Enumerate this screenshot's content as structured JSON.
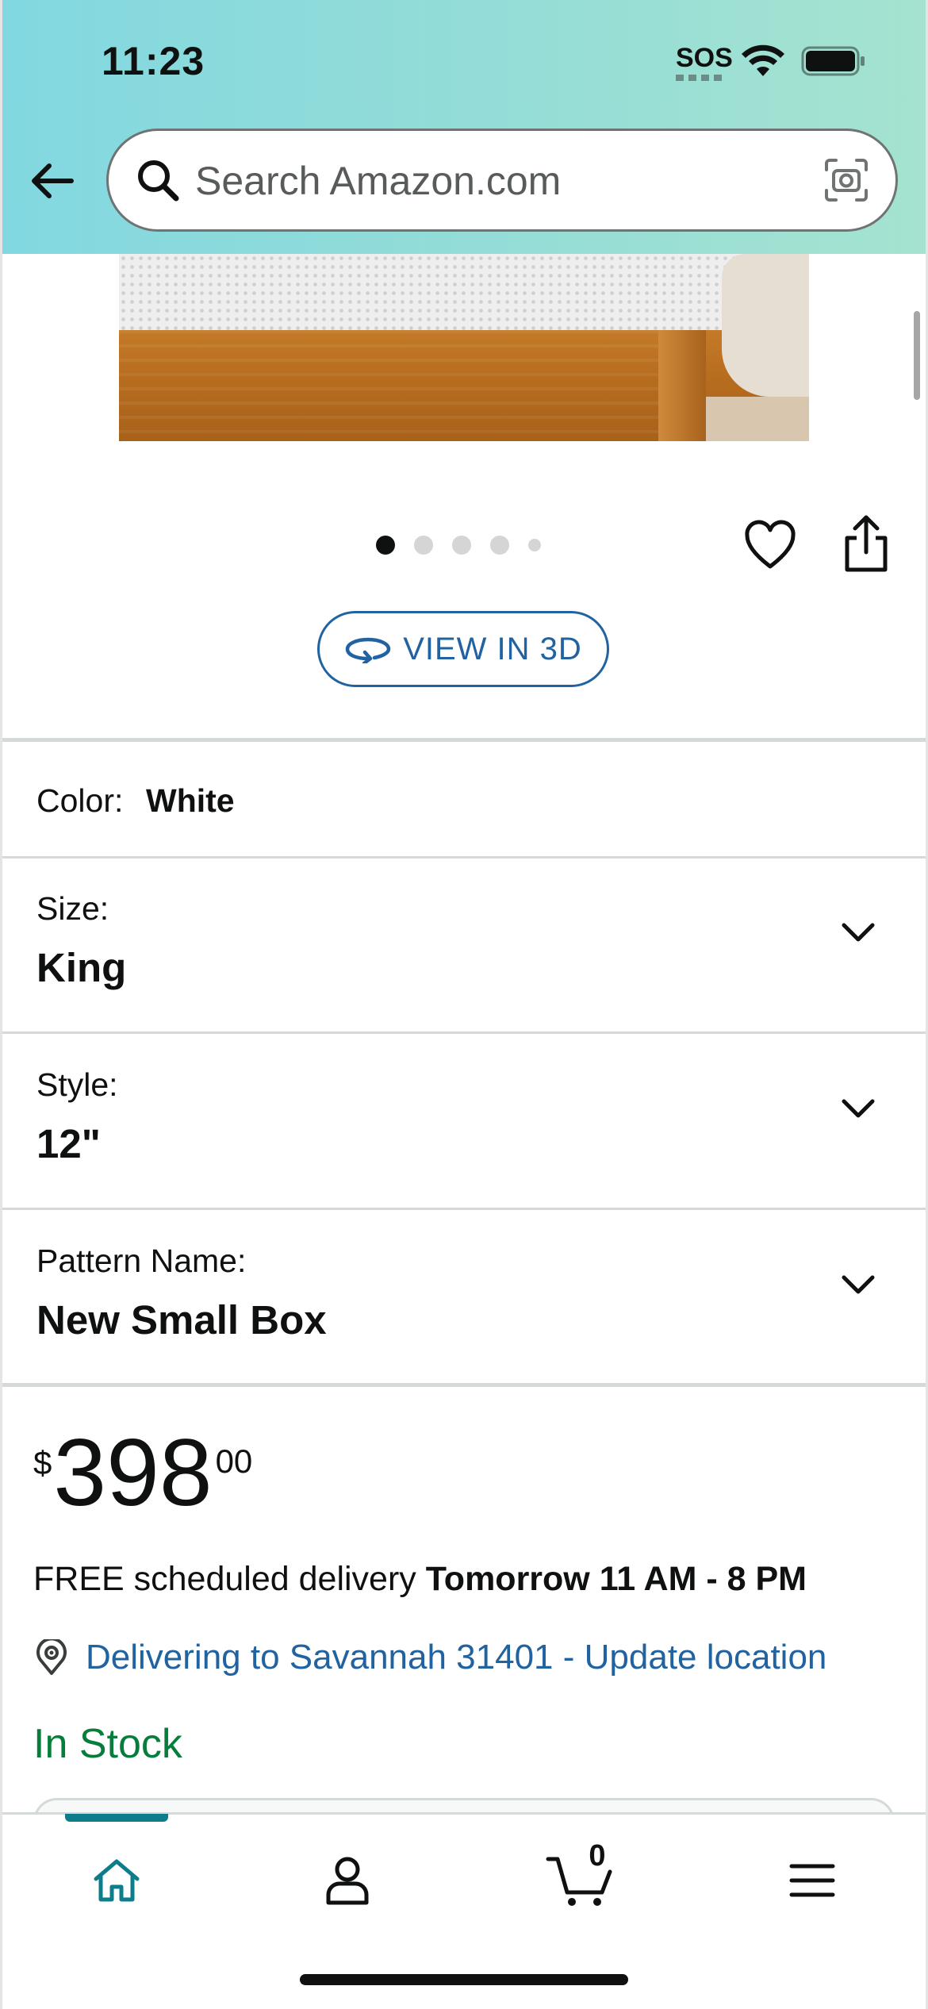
{
  "status_bar": {
    "time": "11:23",
    "sos": "SOS"
  },
  "search": {
    "placeholder": "Search Amazon.com"
  },
  "carousel": {
    "total_images": 5,
    "active_index": 0
  },
  "view_3d": {
    "label": "VIEW IN 3D"
  },
  "variations": {
    "color": {
      "label": "Color:",
      "value": "White"
    },
    "size": {
      "label": "Size:",
      "value": "King"
    },
    "style": {
      "label": "Style:",
      "value": "12\""
    },
    "pattern": {
      "label": "Pattern Name:",
      "value": "New Small Box"
    }
  },
  "price": {
    "symbol": "$",
    "whole": "398",
    "fraction": "00"
  },
  "delivery": {
    "prefix": "FREE scheduled delivery ",
    "window": "Tomorrow 11 AM - 8 PM"
  },
  "location": {
    "link_text": "Delivering to Savannah 31401 - Update location"
  },
  "stock": {
    "status": "In Stock"
  },
  "bottom_nav": {
    "items": [
      "home-icon",
      "account-icon",
      "cart-icon",
      "menu-icon"
    ],
    "active": "home",
    "cart_count": "0"
  },
  "colors": {
    "header_gradient_start": "#82d8e0",
    "header_gradient_end": "#a5e3d0",
    "link_blue": "#2162a1",
    "in_stock_green": "#067d3a",
    "nav_active": "#0d7d8c"
  }
}
